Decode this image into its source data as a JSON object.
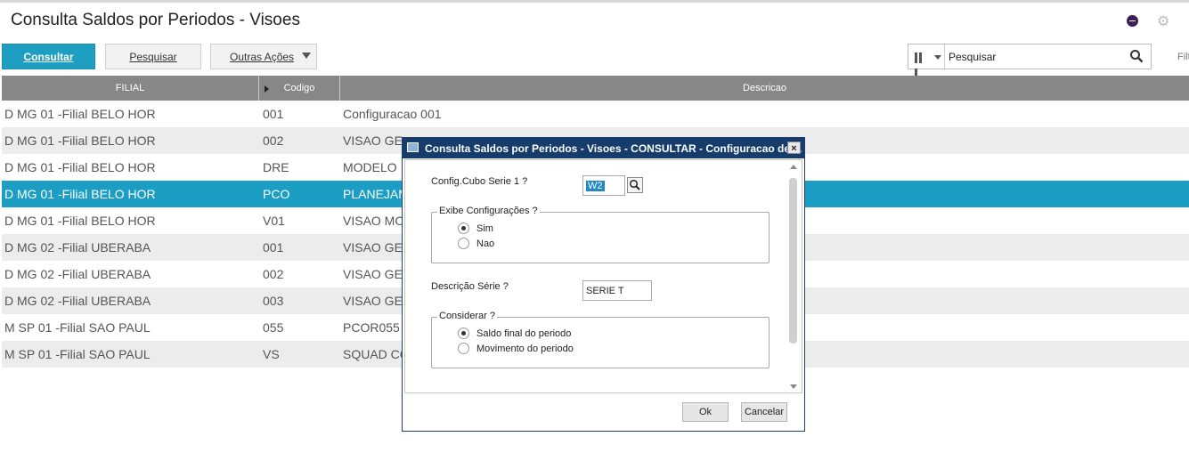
{
  "page": {
    "title": "Consulta Saldos por Periodos - Visoes"
  },
  "toolbar": {
    "consultar": "Consultar",
    "pesquisar": "Pesquisar",
    "outras_acoes": "Outras Ações"
  },
  "search": {
    "placeholder": "Pesquisar",
    "filter_label": "Filt"
  },
  "grid": {
    "headers": {
      "filial": "FILIAL",
      "codigo": "Codigo",
      "descricao": "Descricao"
    },
    "rows": [
      {
        "filial": "D MG 01 -Filial BELO HOR",
        "codigo": "001",
        "descricao": "Configuracao 001"
      },
      {
        "filial": "D MG 01 -Filial BELO HOR",
        "codigo": "002",
        "descricao": "VISAO GE"
      },
      {
        "filial": "D MG 01 -Filial BELO HOR",
        "codigo": "DRE",
        "descricao": "MODELO"
      },
      {
        "filial": "D MG 01 -Filial BELO HOR",
        "codigo": "PCO",
        "descricao": "PLANEJAM"
      },
      {
        "filial": "D MG 01 -Filial BELO HOR",
        "codigo": "V01",
        "descricao": "VISAO MO"
      },
      {
        "filial": "D MG 02 -Filial UBERABA",
        "codigo": "001",
        "descricao": "VISAO GE"
      },
      {
        "filial": "D MG 02 -Filial UBERABA",
        "codigo": "002",
        "descricao": "VISAO GE"
      },
      {
        "filial": "D MG 02 -Filial UBERABA",
        "codigo": "003",
        "descricao": "VISAO GE"
      },
      {
        "filial": "M SP 01 -Filial SAO PAUL",
        "codigo": "055",
        "descricao": "PCOR055"
      },
      {
        "filial": "M SP 01 -Filial SAO PAUL",
        "codigo": "VS",
        "descricao": "SQUAD CO"
      }
    ]
  },
  "dialog": {
    "title": "Consulta Saldos por Periodos - Visoes - CONSULTAR - Configuracao de ...",
    "close": "×",
    "config_label": "Config.Cubo Serie 1 ?",
    "config_value": "W2",
    "exibe_title": "Exibe Configurações ?",
    "exibe_options": [
      "Sim",
      "Nao"
    ],
    "exibe_selected": "Sim",
    "descricao_label": "Descrição Série ?",
    "descricao_value": "SERIE  T",
    "considerar_title": "Considerar  ?",
    "considerar_options": [
      "Saldo final do periodo",
      "Movimento do periodo"
    ],
    "considerar_selected": "Saldo final do periodo",
    "ok": "Ok",
    "cancel": "Cancelar"
  },
  "colors": {
    "accent": "#1e9ec1",
    "selected_row": "#1c9ec4",
    "dialog_title": "#163c6b",
    "grid_header": "#878787"
  }
}
